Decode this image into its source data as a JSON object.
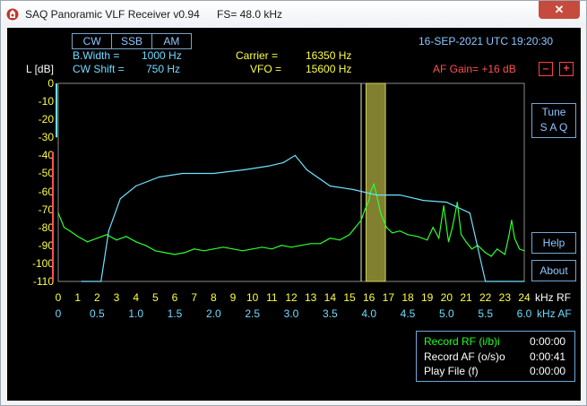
{
  "window": {
    "title": "SAQ Panoramic VLF Receiver v0.94",
    "fs_label": "FS=  48.0 kHz",
    "close_glyph": "✕",
    "icon": "app-icon"
  },
  "modes": [
    "CW",
    "SSB",
    "AM"
  ],
  "bandwidth": {
    "label": "B.Width  =",
    "value": "1000 Hz"
  },
  "cw_shift": {
    "label": "CW  Shift =",
    "value": "750 Hz"
  },
  "carrier": {
    "label": "Carrier =",
    "value": "16350 Hz"
  },
  "vfo": {
    "label": "VFO =",
    "value": "15600 Hz"
  },
  "datetime": "16-SEP-2021 UTC 19:20:30",
  "af_gain": {
    "label": "AF Gain= +16 dB",
    "minus": "–",
    "plus": "+"
  },
  "ylabel": "L [dB]",
  "side_buttons": {
    "tune": "Tune\nS A Q",
    "help": "Help",
    "about": "About"
  },
  "colors": {
    "rf_trace": "#2cff2c",
    "af_trace": "#6fe0ff",
    "yaxis": "#ffff40",
    "rf_axis": "#ffff40",
    "af_axis": "#6fdcff",
    "marker": "#bcbc60",
    "passband": "#808030"
  },
  "chart_data": {
    "type": "line",
    "ylabel": "L [dB]",
    "y_ticks": [
      0,
      -10,
      -20,
      -30,
      -40,
      -50,
      -60,
      -70,
      -80,
      -90,
      -100,
      -110
    ],
    "ylim": [
      -110,
      0
    ],
    "x_rf": {
      "unit_label": "kHz RF",
      "ticks": [
        "0",
        "1",
        "2",
        "3",
        "4",
        "5",
        "6",
        "7",
        "8",
        "9",
        "10",
        "11",
        "12",
        "13",
        "14",
        "15",
        "16",
        "17",
        "18",
        "19",
        "20",
        "21",
        "22",
        "23",
        "24"
      ],
      "range": [
        0,
        24
      ]
    },
    "x_af": {
      "unit_label": "kHz AF",
      "ticks": [
        "0",
        "0.5",
        "1.0",
        "1.5",
        "2.0",
        "2.5",
        "3.0",
        "3.5",
        "4.0",
        "4.5",
        "5.0",
        "5.5",
        "6.0"
      ],
      "range": [
        0,
        6.0
      ]
    },
    "marker_khz": 15.6,
    "passband_khz": [
      15.85,
      16.85
    ],
    "series": [
      {
        "id": "rf",
        "x": [
          0,
          0.3,
          0.6,
          1,
          1.5,
          2,
          2.5,
          3,
          3.5,
          4,
          4.5,
          5,
          5.5,
          6,
          6.5,
          7,
          7.5,
          8,
          8.5,
          9,
          9.5,
          10,
          10.5,
          11,
          11.5,
          12,
          12.5,
          13,
          13.5,
          14,
          14.5,
          15,
          15.3,
          15.6,
          15.8,
          16,
          16.1,
          16.25,
          16.4,
          16.6,
          16.9,
          17.2,
          17.6,
          18,
          18.5,
          19,
          19.3,
          19.6,
          19.85,
          20.1,
          20.3,
          20.55,
          20.75,
          21,
          21.3,
          21.6,
          22,
          22.3,
          22.6,
          23,
          23.2,
          23.35,
          23.5,
          23.75,
          24
        ],
        "y": [
          -72,
          -80,
          -82,
          -85,
          -88,
          -86,
          -84,
          -87,
          -85,
          -88,
          -90,
          -93,
          -94,
          -95,
          -94,
          -92,
          -93,
          -92,
          -91,
          -92,
          -93,
          -92,
          -91,
          -92,
          -90,
          -91,
          -90,
          -89,
          -89,
          -86,
          -87,
          -84,
          -80,
          -76,
          -70,
          -65,
          -60,
          -56,
          -62,
          -72,
          -80,
          -83,
          -82,
          -84,
          -85,
          -87,
          -80,
          -86,
          -68,
          -88,
          -80,
          -66,
          -84,
          -88,
          -92,
          -90,
          -94,
          -96,
          -92,
          -95,
          -85,
          -76,
          -86,
          -92,
          -93
        ]
      },
      {
        "id": "af",
        "x": [
          0.3,
          0.55,
          0.65,
          0.8,
          1.0,
          1.3,
          1.6,
          2.0,
          2.4,
          2.7,
          2.9,
          3.05,
          3.2,
          3.5,
          3.8,
          4.1,
          4.4,
          4.7,
          5.0,
          5.3,
          5.5,
          5.7,
          6.0
        ],
        "y": [
          -110,
          -110,
          -82,
          -64,
          -57,
          -52,
          -50,
          -50,
          -48,
          -46,
          -44,
          -40,
          -48,
          -57,
          -59,
          -62,
          -62,
          -65,
          -66,
          -72,
          -110,
          -110,
          -110
        ]
      }
    ]
  },
  "recorder": [
    {
      "label": "Record  RF (i/b)i",
      "time": "0:00:00"
    },
    {
      "label": "Record  AF (o/s)o",
      "time": "0:00:41"
    },
    {
      "label": "Play File (f)",
      "time": "0:00:00"
    }
  ]
}
